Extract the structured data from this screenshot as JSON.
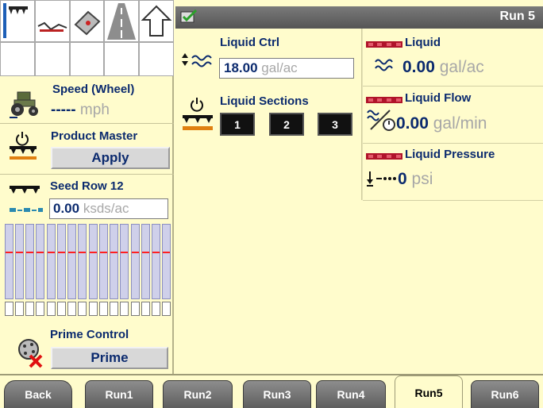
{
  "header": {
    "title": "Run 5"
  },
  "left": {
    "speed": {
      "title": "Speed (Wheel)",
      "value": "-----",
      "unit": "mph"
    },
    "product_master": {
      "title": "Product Master",
      "button": "Apply"
    },
    "seed_row": {
      "title": "Seed Row 12",
      "value": "0.00",
      "unit": "ksds/ac"
    },
    "prime_control": {
      "title": "Prime Control",
      "button": "Prime"
    }
  },
  "liquid_ctrl": {
    "title": "Liquid Ctrl",
    "value": "18.00",
    "unit": "gal/ac"
  },
  "liquid_sections": {
    "title": "Liquid Sections",
    "buttons": [
      "1",
      "2",
      "3"
    ]
  },
  "liquid": {
    "title": "Liquid",
    "value": "0.00",
    "unit": "gal/ac"
  },
  "liquid_flow": {
    "title": "Liquid Flow",
    "value": "0.00",
    "unit": "gal/min"
  },
  "liquid_pressure": {
    "title": "Liquid Pressure",
    "value": "0",
    "unit": "psi"
  },
  "tabs": [
    "Back",
    "Run1",
    "Run2",
    "Run3",
    "Run4",
    "Run5",
    "Run6"
  ],
  "active_tab": "Run5",
  "colors": {
    "label_blue": "#0b2a6e",
    "background": "#fffccc",
    "header_gray": "#666666",
    "alert_red": "#ff2020"
  }
}
